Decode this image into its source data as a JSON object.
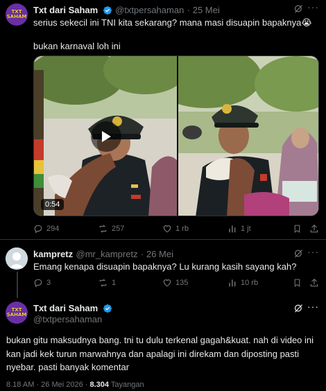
{
  "main_tweet": {
    "author_name": "Txt dari Saham",
    "handle": "@txtpersahaman",
    "date": "25 Mei",
    "avatar_text": "TXT\nSAHAM",
    "text_line1": "serius sekecil ini TNI kita sekarang? mana masi disuapin bapaknya😭",
    "text_line2": "bukan karnaval loh ini",
    "video_duration": "0:54",
    "replies": "294",
    "retweets": "257",
    "likes": "1 rb",
    "views": "1 jt"
  },
  "reply": {
    "author_name": "kampretz",
    "handle": "@mr_kampretz",
    "date": "26 Mei",
    "text": "Emang kenapa disuapin bapaknya? Lu kurang kasih sayang kah?",
    "replies": "3",
    "retweets": "1",
    "likes": "135",
    "views": "10 rb"
  },
  "focus_tweet": {
    "author_name": "Txt dari Saham",
    "handle": "@txtpersahaman",
    "avatar_text": "TXT\nSAHAM",
    "text": "bukan gitu maksudnya bang. tni tu dulu terkenal gagah&kuat. nah di video ini kan jadi kek turun marwahnya dan apalagi ini direkam dan diposting pasti nyebar. pasti banyak komentar",
    "time": "8.18 AM",
    "date": "26 Mei 2026",
    "views_count": "8.304",
    "views_label": "Tayangan"
  },
  "colors": {
    "background": "#000000",
    "text": "#e7e9ea",
    "muted": "#71767b",
    "verified": "#1d9bf0",
    "divider": "#2f3336"
  }
}
